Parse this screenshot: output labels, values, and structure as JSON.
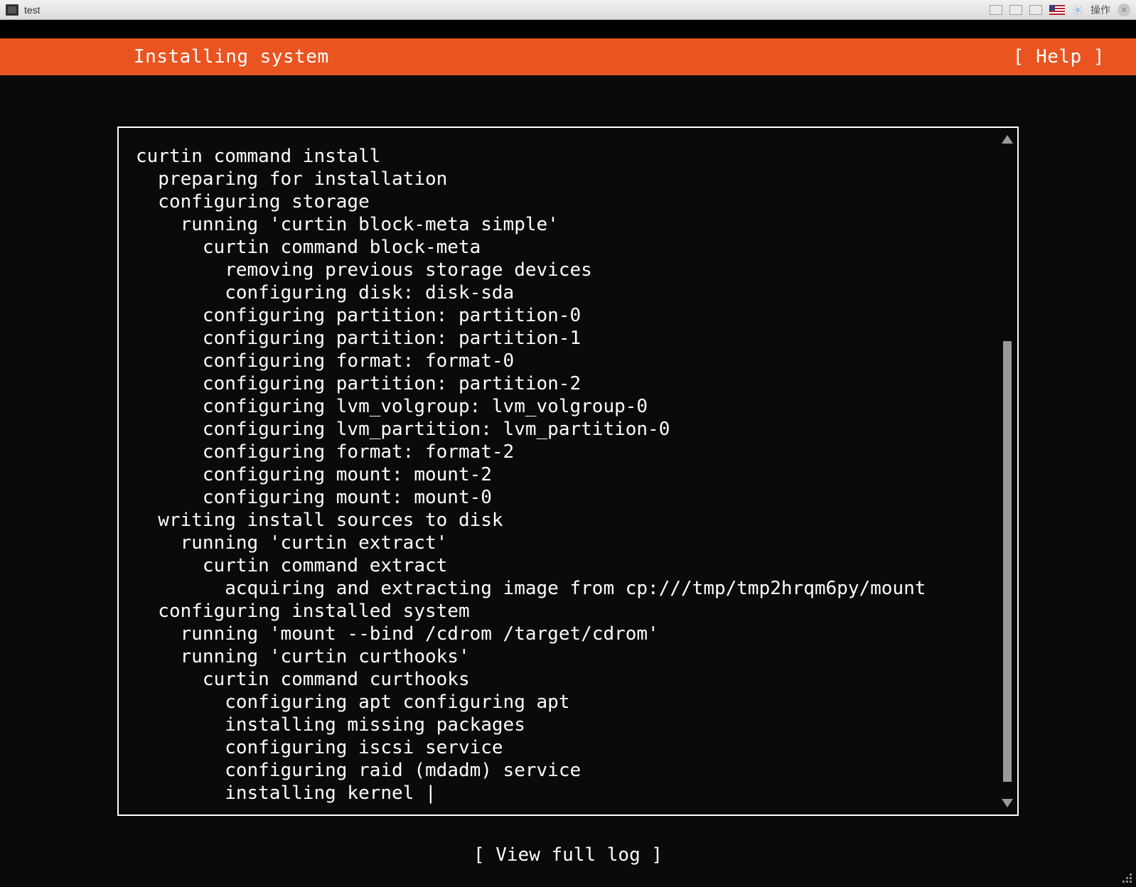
{
  "window": {
    "title": "test",
    "actions_label": "操作"
  },
  "header": {
    "title": "Installing system",
    "help_label": "[ Help ]"
  },
  "log_lines": [
    {
      "indent": 0,
      "text": "curtin command install"
    },
    {
      "indent": 1,
      "text": "preparing for installation"
    },
    {
      "indent": 1,
      "text": "configuring storage"
    },
    {
      "indent": 2,
      "text": "running 'curtin block-meta simple'"
    },
    {
      "indent": 3,
      "text": "curtin command block-meta"
    },
    {
      "indent": 4,
      "text": "removing previous storage devices"
    },
    {
      "indent": 4,
      "text": "configuring disk: disk-sda"
    },
    {
      "indent": 3,
      "text": "configuring partition: partition-0"
    },
    {
      "indent": 3,
      "text": "configuring partition: partition-1"
    },
    {
      "indent": 3,
      "text": "configuring format: format-0"
    },
    {
      "indent": 3,
      "text": "configuring partition: partition-2"
    },
    {
      "indent": 3,
      "text": "configuring lvm_volgroup: lvm_volgroup-0"
    },
    {
      "indent": 3,
      "text": "configuring lvm_partition: lvm_partition-0"
    },
    {
      "indent": 3,
      "text": "configuring format: format-2"
    },
    {
      "indent": 3,
      "text": "configuring mount: mount-2"
    },
    {
      "indent": 3,
      "text": "configuring mount: mount-0"
    },
    {
      "indent": 1,
      "text": "writing install sources to disk"
    },
    {
      "indent": 2,
      "text": "running 'curtin extract'"
    },
    {
      "indent": 3,
      "text": "curtin command extract"
    },
    {
      "indent": 4,
      "text": "acquiring and extracting image from cp:///tmp/tmp2hrqm6py/mount"
    },
    {
      "indent": 1,
      "text": "configuring installed system"
    },
    {
      "indent": 2,
      "text": "running 'mount --bind /cdrom /target/cdrom'"
    },
    {
      "indent": 2,
      "text": "running 'curtin curthooks'"
    },
    {
      "indent": 3,
      "text": "curtin command curthooks"
    },
    {
      "indent": 4,
      "text": "configuring apt configuring apt"
    },
    {
      "indent": 4,
      "text": "installing missing packages"
    },
    {
      "indent": 4,
      "text": "configuring iscsi service"
    },
    {
      "indent": 4,
      "text": "configuring raid (mdadm) service"
    },
    {
      "indent": 4,
      "text": "installing kernel |"
    }
  ],
  "footer": {
    "view_log_label": "[ View full log ]"
  },
  "colors": {
    "accent": "#e95420",
    "background": "#0a0a0a",
    "text": "#ffffff"
  }
}
